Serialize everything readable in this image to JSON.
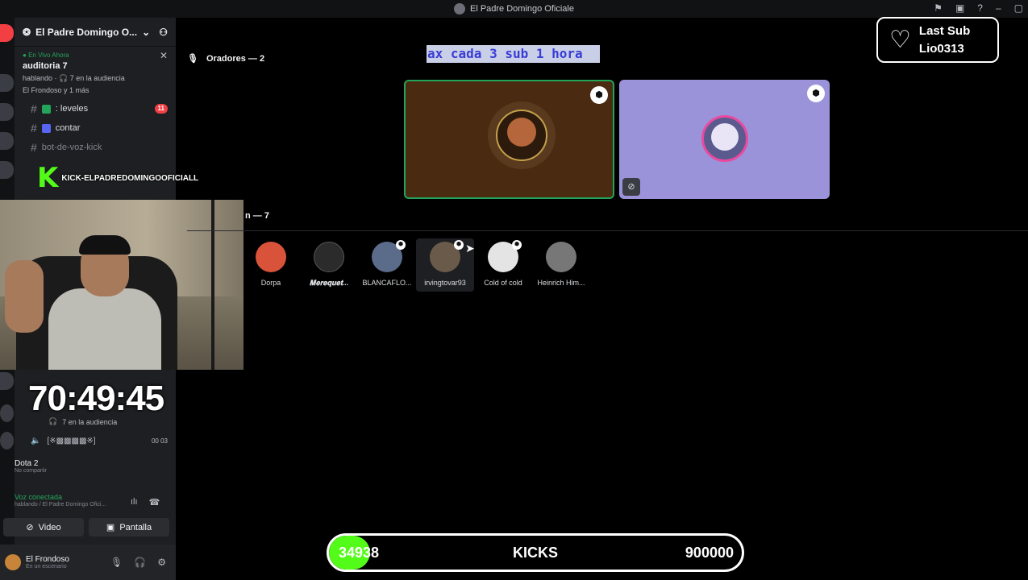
{
  "window": {
    "title": "El Padre Domingo Oficiale"
  },
  "server": {
    "name": "El Padre Domingo O..."
  },
  "live_panel": {
    "status": "En Vivo Ahora",
    "channel": "auditoria 7",
    "speaking": "hablando · 🎧 7 en la audiencia",
    "members": "El Frondoso y 1 más"
  },
  "channels": [
    {
      "name": ": leveles",
      "badge": "11"
    },
    {
      "name": "contar",
      "badge": ""
    },
    {
      "name": "bot-de-voz-kick",
      "badge": ""
    }
  ],
  "kick_overlay": {
    "letter": "K",
    "tag": "KICK-ELPADREDOMINGOOFICIALL"
  },
  "timer": "70:49:45",
  "audience_line": "7 en la audiencia",
  "volume_value": "00  03",
  "game": {
    "title": "Dota 2",
    "sub": "No compartir"
  },
  "voice": {
    "status": "Voz conectada",
    "detail": "hablando / El Padre Domingo Ofici..."
  },
  "buttons": {
    "video": "Video",
    "screen": "Pantalla"
  },
  "user": {
    "name": "El Frondoso",
    "status": "En un escenario"
  },
  "stage": {
    "speakers_label": "Oradores — 2",
    "audience_label": "n — 7"
  },
  "ticker": "ax cada 3 sub  1 hora",
  "last_sub": {
    "line1": "Last Sub",
    "line2": "Lio0313"
  },
  "audience": [
    {
      "name": "Dorpa",
      "color": "#d9533b",
      "badge": false
    },
    {
      "name": "𝐌𝐞𝐫𝐞𝐪𝐮𝐞𝐭...",
      "color": "#2b2b2b",
      "badge": false
    },
    {
      "name": "BLANCAFLO...",
      "color": "#5b6b8a",
      "badge": true
    },
    {
      "name": "irvingtovar93",
      "color": "#6a5a4a",
      "badge": true
    },
    {
      "name": "Cold of cold",
      "color": "#e4e4e4",
      "badge": true
    },
    {
      "name": "Heinrich Him...",
      "color": "#777777",
      "badge": false
    }
  ],
  "kicks": {
    "current": "34938",
    "label": "KICKS",
    "goal": "900000",
    "fraction": 0.0388
  },
  "colors": {
    "accent_green": "#53fc18",
    "discord_bg": "#1e1f22",
    "ticker_text": "#3a3cd6"
  }
}
